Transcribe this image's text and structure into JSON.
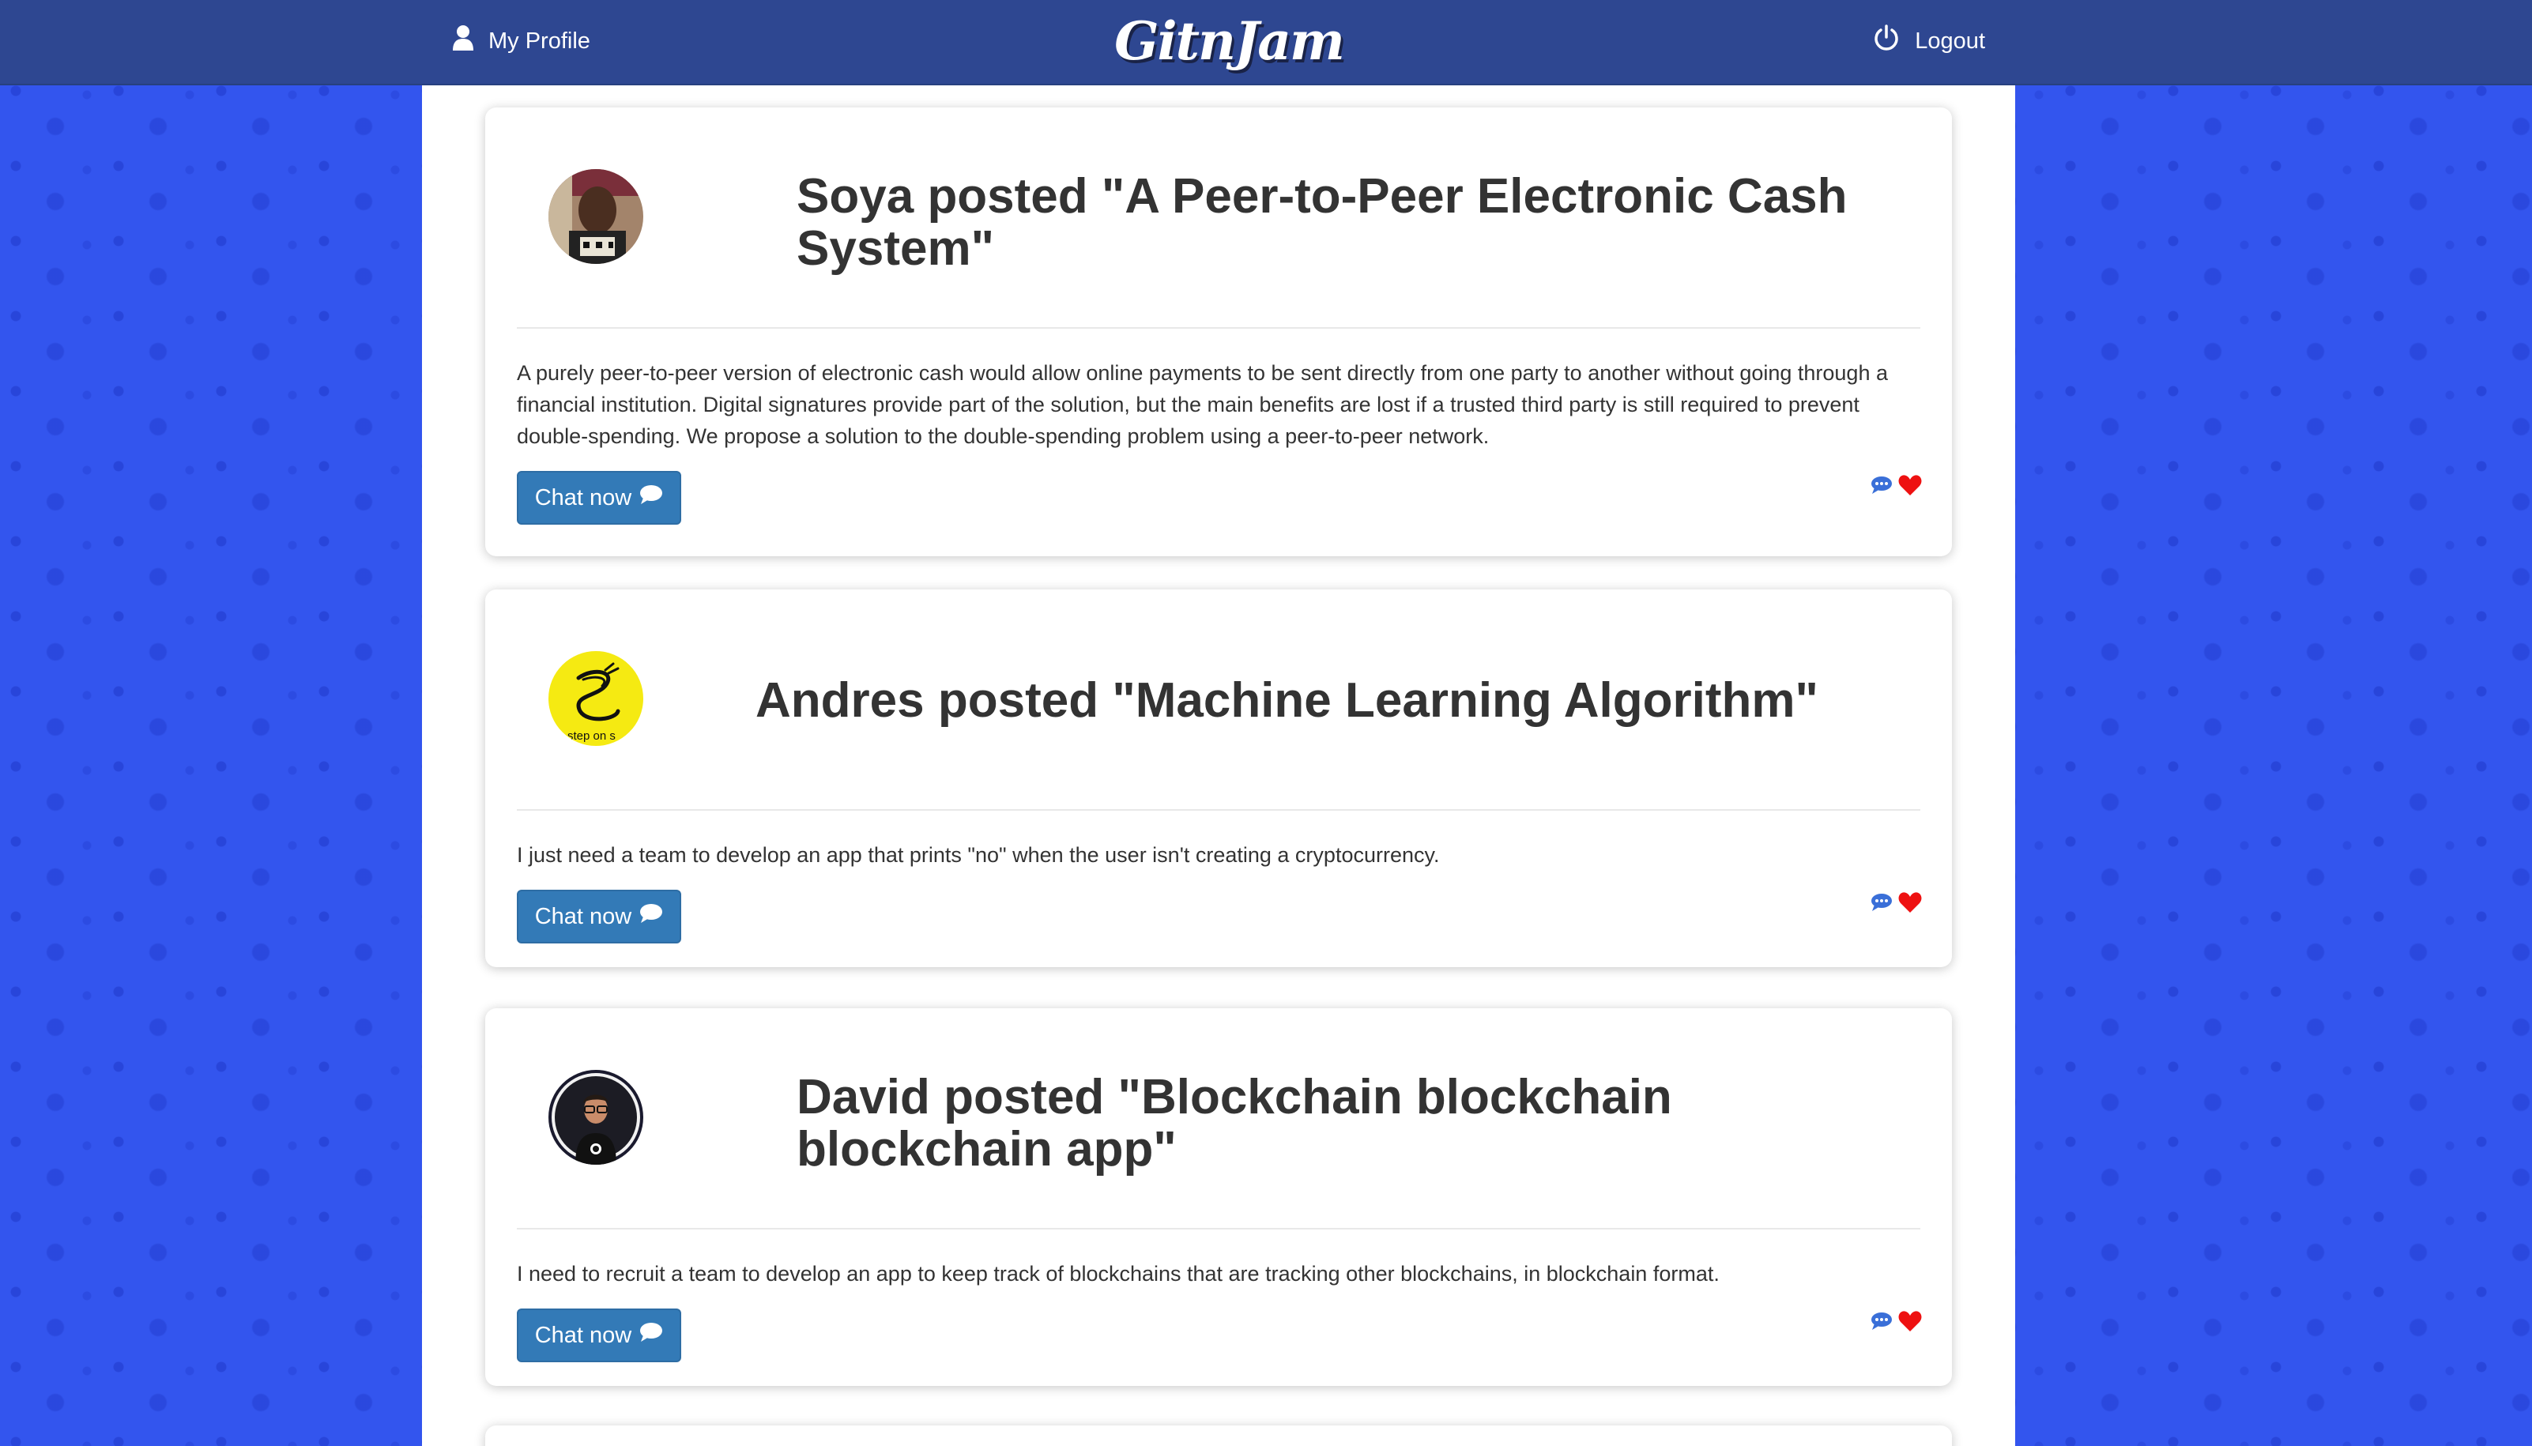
{
  "header": {
    "profile_label": "My Profile",
    "brand": "GitnJam",
    "logout_label": "Logout"
  },
  "colors": {
    "navbar": "#2e4791",
    "page_background": "#3355ee",
    "button_primary": "#337ab7",
    "heart": "#ee1111",
    "comment_icon": "#3a6fd8"
  },
  "posts": [
    {
      "author": "Soya",
      "posted_word": "posted",
      "title": "\"A Peer-to-Peer Electronic Cash System\"",
      "body": "A purely peer-to-peer version of electronic cash would allow online payments to be sent directly from one party to another without going through a financial institution. Digital signatures provide part of the solution, but the main benefits are lost if a trusted third party is still required to prevent double-spending. We propose a solution to the double-spending problem using a peer-to-peer network.",
      "chat_label": "Chat now"
    },
    {
      "author": "Andres",
      "posted_word": "posted",
      "title": "\"Machine Learning Algorithm\"",
      "body": "I just need a team to develop an app that prints \"no\" when the user isn't creating a cryptocurrency.",
      "chat_label": "Chat now",
      "avatar_text": "step on s"
    },
    {
      "author": "David",
      "posted_word": "posted",
      "title": "\"Blockchain blockchain blockchain app\"",
      "body": "I need to recruit a team to develop an app to keep track of blockchains that are tracking other blockchains, in blockchain format.",
      "chat_label": "Chat now"
    }
  ]
}
